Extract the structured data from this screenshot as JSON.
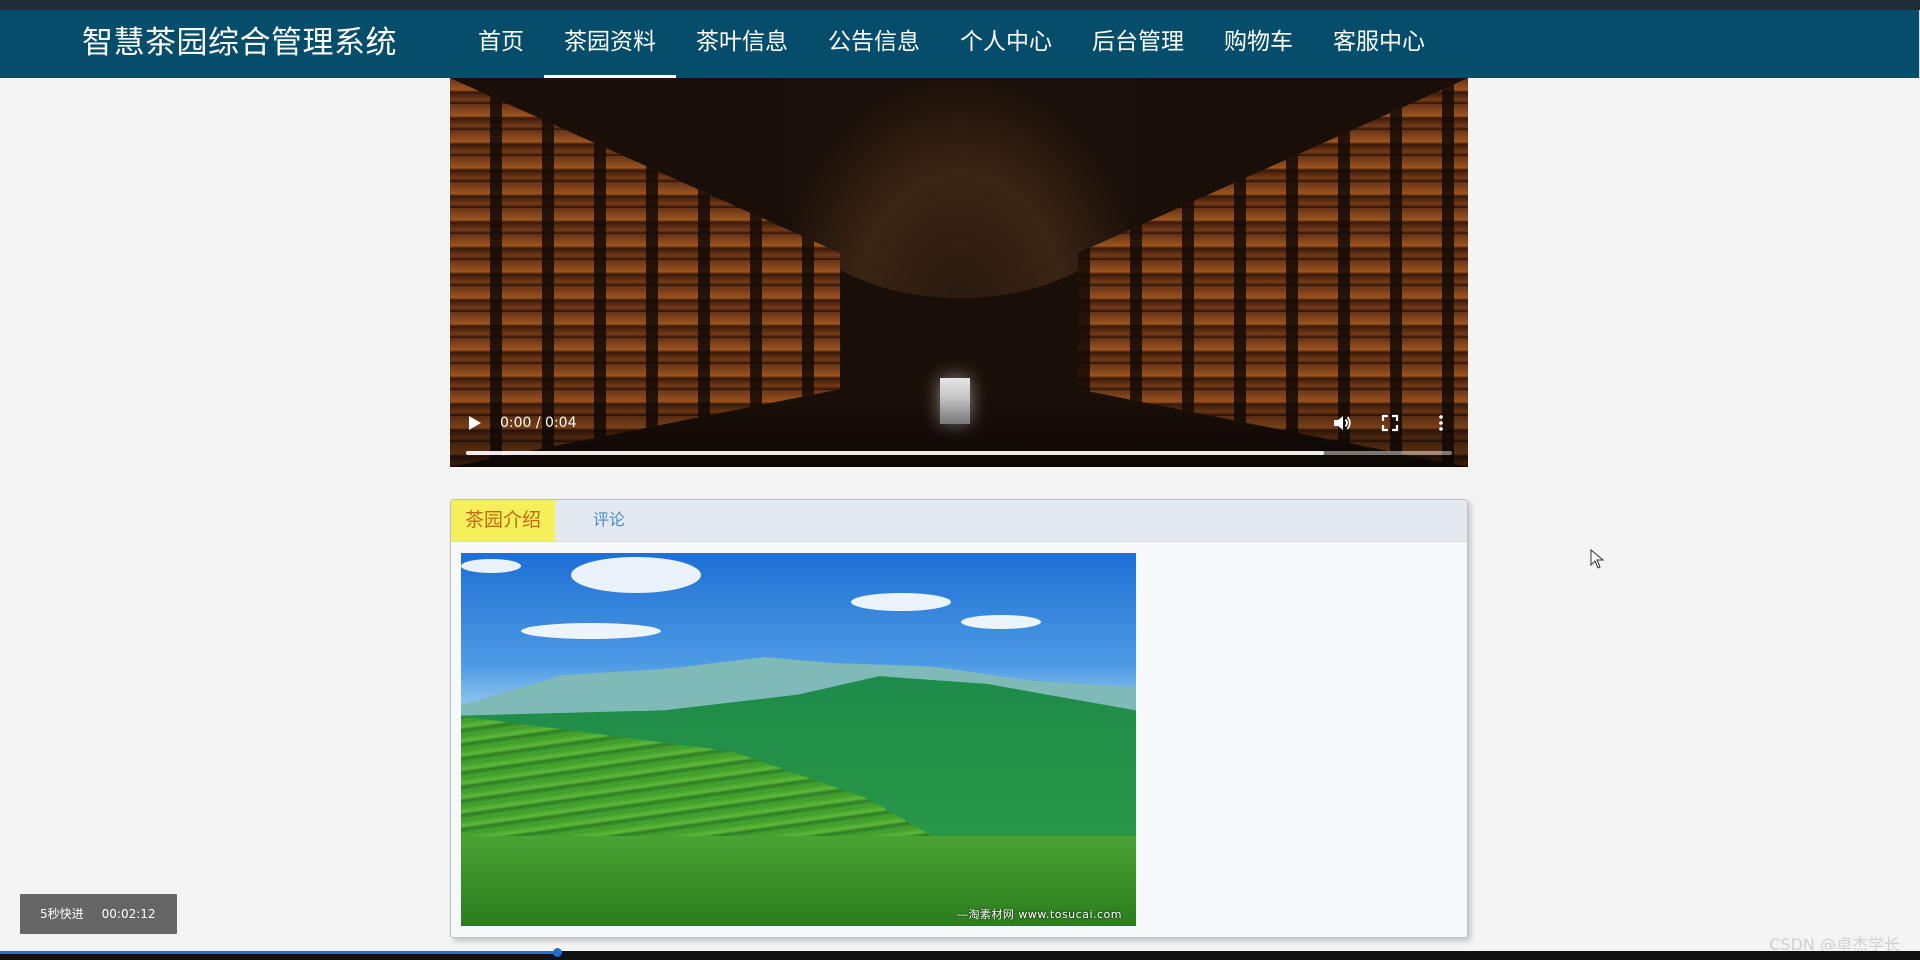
{
  "header": {
    "brand": "智慧茶园综合管理系统",
    "nav": [
      {
        "label": "首页",
        "active": false
      },
      {
        "label": "茶园资料",
        "active": true
      },
      {
        "label": "茶叶信息",
        "active": false
      },
      {
        "label": "公告信息",
        "active": false
      },
      {
        "label": "个人中心",
        "active": false
      },
      {
        "label": "后台管理",
        "active": false
      },
      {
        "label": "购物车",
        "active": false
      },
      {
        "label": "客服中心",
        "active": false
      }
    ]
  },
  "video": {
    "time": "0:00 / 0:04",
    "progress_fraction": 0.87,
    "icons": [
      "play-icon",
      "volume-icon",
      "fullscreen-icon",
      "more-options-icon"
    ]
  },
  "panel": {
    "tabs": [
      {
        "label": "茶园介绍",
        "active": true
      },
      {
        "label": "评论",
        "active": false
      }
    ],
    "image_caption": "—淘素材网 www.tosucai.com"
  },
  "player_overlay": {
    "skip_label": "5秒快进",
    "clock": "00:02:12"
  },
  "watermark": "CSDN @卓杰学长",
  "bottom_progress_fraction": 0.29,
  "colors": {
    "navbar": "#064c6b",
    "active_tab_bg": "#f5f05a",
    "active_tab_text": "#c06a15",
    "inactive_tab_text": "#4a8ec0"
  }
}
